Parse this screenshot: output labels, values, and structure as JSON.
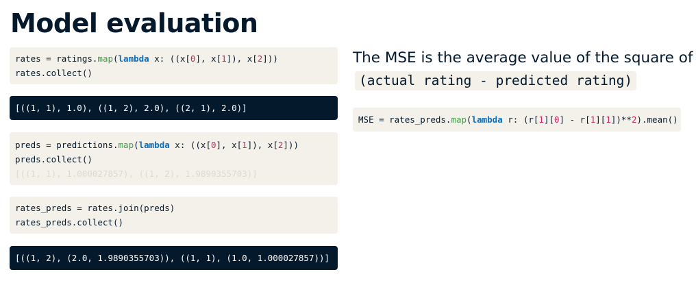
{
  "slide": {
    "title": "Model evaluation"
  },
  "code_blocks": {
    "rates_map": {
      "line1": {
        "a": "rates = ratings.",
        "fn": "map",
        "b": "(",
        "kw": "lambda",
        "c": " x: ((x[",
        "n1": "0",
        "d": "], x[",
        "n2": "1",
        "e": "]), x[",
        "n3": "2",
        "f": "]))"
      },
      "line2": "rates.collect()"
    },
    "rates_output": "[((1, 1), 1.0), ((1, 2), 2.0), ((2, 1), 2.0)]",
    "preds_map": {
      "line1": {
        "a": "preds = predictions.",
        "fn": "map",
        "b": "(",
        "kw": "lambda",
        "c": " x: ((x[",
        "n1": "0",
        "d": "], x[",
        "n2": "1",
        "e": "]), x[",
        "n3": "2",
        "f": "]))"
      },
      "line2": "preds.collect()",
      "faded_output": "[((1, 1), 1.000027857), ((1, 2), 1.9890355703)]"
    },
    "join": {
      "line1": "rates_preds = rates.join(preds)",
      "line2": "rates_preds.collect()"
    },
    "join_output": "[((1, 2), (2.0, 1.9890355703)), ((1, 1), (1.0, 1.000027857))]"
  },
  "explanation": {
    "text": "The MSE is the average value of the square of",
    "inline_code": "(actual rating - predicted rating)"
  },
  "mse_code": {
    "a": "MSE = rates_preds.",
    "fn": "map",
    "b": "(",
    "kw": "lambda",
    "c": " r: (r[",
    "n1": "1",
    "d": "][",
    "n2": "0",
    "e": "] - r[",
    "n3": "1",
    "f": "][",
    "n4": "1",
    "g": "])**",
    "n5": "2",
    "h": ").mean()"
  },
  "colors": {
    "code_bg_light": "#f4f0ea",
    "code_bg_dark": "#05192d",
    "keyword": "#0b6ec0",
    "function": "#38a340",
    "number": "#d0235f",
    "text": "#05192d"
  }
}
